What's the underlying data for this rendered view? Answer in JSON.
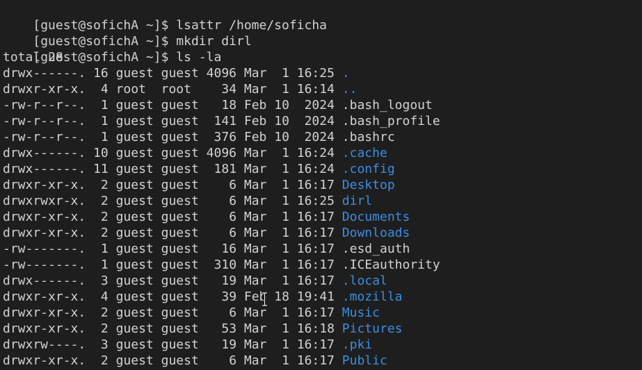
{
  "colors": {
    "background": "#1e1e1e",
    "text": "#d3d3d3",
    "directory": "#3c8de2"
  },
  "commands": [
    {
      "prompt": "[guest@sofichA ~]$",
      "command": "lsattr /home/soficha"
    },
    {
      "prompt": "[guest@sofichA ~]$",
      "command": "mkdir dirl"
    },
    {
      "prompt": "[guest@sofichA ~]$",
      "command": "ls -la"
    }
  ],
  "total_line": "total 28",
  "listing": [
    {
      "perms": "drwx------.",
      "links": "16",
      "owner": "guest",
      "group": "guest",
      "size": "4096",
      "month": "Mar",
      "day": "1",
      "time": "16:25",
      "name": ".",
      "type": "dir"
    },
    {
      "perms": "drwxr-xr-x.",
      "links": "4",
      "owner": "root",
      "group": "root",
      "size": "34",
      "month": "Mar",
      "day": "1",
      "time": "16:14",
      "name": "..",
      "type": "dir"
    },
    {
      "perms": "-rw-r--r--.",
      "links": "1",
      "owner": "guest",
      "group": "guest",
      "size": "18",
      "month": "Feb",
      "day": "10",
      "time": "2024",
      "name": ".bash_logout",
      "type": "file"
    },
    {
      "perms": "-rw-r--r--.",
      "links": "1",
      "owner": "guest",
      "group": "guest",
      "size": "141",
      "month": "Feb",
      "day": "10",
      "time": "2024",
      "name": ".bash_profile",
      "type": "file"
    },
    {
      "perms": "-rw-r--r--.",
      "links": "1",
      "owner": "guest",
      "group": "guest",
      "size": "376",
      "month": "Feb",
      "day": "10",
      "time": "2024",
      "name": ".bashrc",
      "type": "file"
    },
    {
      "perms": "drwx------.",
      "links": "10",
      "owner": "guest",
      "group": "guest",
      "size": "4096",
      "month": "Mar",
      "day": "1",
      "time": "16:24",
      "name": ".cache",
      "type": "dir"
    },
    {
      "perms": "drwx------.",
      "links": "11",
      "owner": "guest",
      "group": "guest",
      "size": "181",
      "month": "Mar",
      "day": "1",
      "time": "16:24",
      "name": ".config",
      "type": "dir"
    },
    {
      "perms": "drwxr-xr-x.",
      "links": "2",
      "owner": "guest",
      "group": "guest",
      "size": "6",
      "month": "Mar",
      "day": "1",
      "time": "16:17",
      "name": "Desktop",
      "type": "dir"
    },
    {
      "perms": "drwxrwxr-x.",
      "links": "2",
      "owner": "guest",
      "group": "guest",
      "size": "6",
      "month": "Mar",
      "day": "1",
      "time": "16:25",
      "name": "dirl",
      "type": "dir"
    },
    {
      "perms": "drwxr-xr-x.",
      "links": "2",
      "owner": "guest",
      "group": "guest",
      "size": "6",
      "month": "Mar",
      "day": "1",
      "time": "16:17",
      "name": "Documents",
      "type": "dir"
    },
    {
      "perms": "drwxr-xr-x.",
      "links": "2",
      "owner": "guest",
      "group": "guest",
      "size": "6",
      "month": "Mar",
      "day": "1",
      "time": "16:17",
      "name": "Downloads",
      "type": "dir"
    },
    {
      "perms": "-rw-------.",
      "links": "1",
      "owner": "guest",
      "group": "guest",
      "size": "16",
      "month": "Mar",
      "day": "1",
      "time": "16:17",
      "name": ".esd_auth",
      "type": "file"
    },
    {
      "perms": "-rw-------.",
      "links": "1",
      "owner": "guest",
      "group": "guest",
      "size": "310",
      "month": "Mar",
      "day": "1",
      "time": "16:17",
      "name": ".ICEauthority",
      "type": "file"
    },
    {
      "perms": "drwx------.",
      "links": "3",
      "owner": "guest",
      "group": "guest",
      "size": "19",
      "month": "Mar",
      "day": "1",
      "time": "16:17",
      "name": ".local",
      "type": "dir"
    },
    {
      "perms": "drwxr-xr-x.",
      "links": "4",
      "owner": "guest",
      "group": "guest",
      "size": "39",
      "month": "Feb",
      "day": "18",
      "time": "19:41",
      "name": ".mozilla",
      "type": "dir"
    },
    {
      "perms": "drwxr-xr-x.",
      "links": "2",
      "owner": "guest",
      "group": "guest",
      "size": "6",
      "month": "Mar",
      "day": "1",
      "time": "16:17",
      "name": "Music",
      "type": "dir"
    },
    {
      "perms": "drwxr-xr-x.",
      "links": "2",
      "owner": "guest",
      "group": "guest",
      "size": "53",
      "month": "Mar",
      "day": "1",
      "time": "16:18",
      "name": "Pictures",
      "type": "dir"
    },
    {
      "perms": "drwxrw----.",
      "links": "3",
      "owner": "guest",
      "group": "guest",
      "size": "19",
      "month": "Mar",
      "day": "1",
      "time": "16:17",
      "name": ".pki",
      "type": "dir"
    },
    {
      "perms": "drwxr-xr-x.",
      "links": "2",
      "owner": "guest",
      "group": "guest",
      "size": "6",
      "month": "Mar",
      "day": "1",
      "time": "16:17",
      "name": "Public",
      "type": "dir"
    }
  ],
  "icons": {
    "text_cursor": "i-beam-cursor-icon"
  }
}
